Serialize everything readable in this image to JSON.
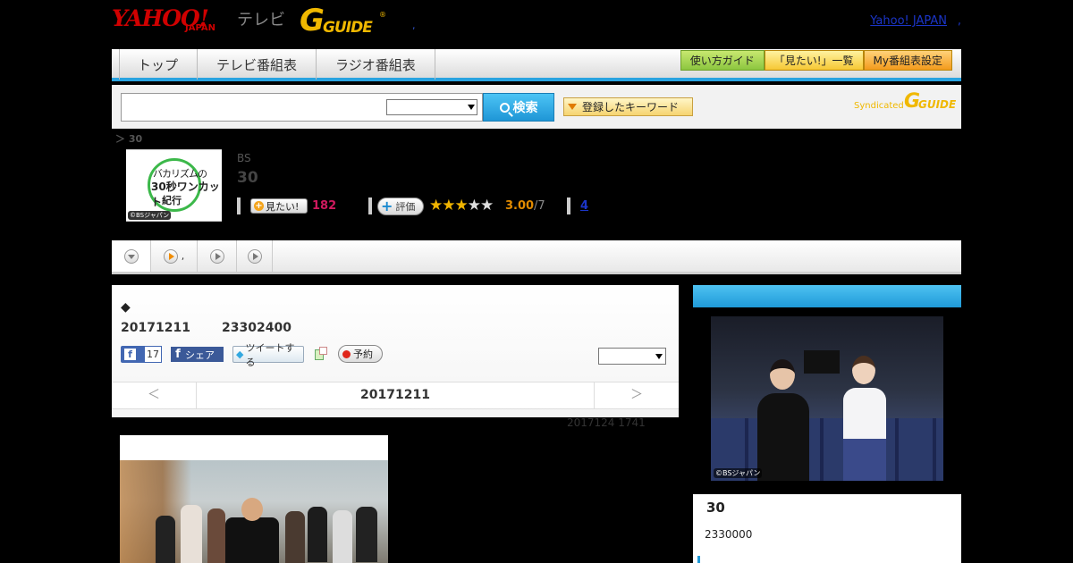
{
  "header": {
    "logo_yahoo": "YAHOO!",
    "logo_japan": "JAPAN",
    "logo_tv": "テレビ",
    "logo_g": "G",
    "logo_guide": "GUIDE",
    "logo_reg": "®",
    "dot": ",",
    "yahoo_japan_link": "Yahoo! JAPAN",
    "yahoo_japan_dot": ","
  },
  "nav": {
    "tabs": [
      {
        "label": "トップ"
      },
      {
        "label": "テレビ番組表"
      },
      {
        "label": "ラジオ番組表"
      }
    ],
    "buttons": [
      {
        "label": "使い方ガイド",
        "color": "#8cc63f"
      },
      {
        "label": "「見たい!」一覧",
        "color": "#f6c834"
      },
      {
        "label": "My番組表設定",
        "color": "#f39a1c"
      }
    ],
    "accent": "#29a3e0"
  },
  "search": {
    "input_value": "",
    "select_value": "",
    "search_button": "検索",
    "keyword_button": "登録したキーワード",
    "syndicated_label": "Syndicated",
    "syndicated_g": "G",
    "syndicated_guide": "GUIDE"
  },
  "breadcrumb": "＞ 30",
  "program": {
    "image_text_1": "バカリズムの",
    "image_text_2": "30秒ワンカット",
    "image_text_3": "紀行",
    "image_copyright": "©BSジャパン",
    "channel": "BS",
    "title": "30",
    "mitai_button": "見たい!",
    "mitai_count": "182",
    "hyoka_button": "評価",
    "rating_stars": 3,
    "rating_max": 5,
    "score": "3.00",
    "score_denominator": "/7",
    "reviews_link": "4"
  },
  "subtabs": {
    "tab2_label": ","
  },
  "main": {
    "diamond": "◆",
    "date": "20171211",
    "time": "23302400",
    "fb_count": "17",
    "fb_share": "シェア",
    "tweet": "ツイートする",
    "yoyaku": "予約",
    "select_value": "",
    "prev": "＜",
    "current_date": "20171211",
    "next": "＞",
    "updated": "2017124  1741"
  },
  "side": {
    "photo_copyright": "©BSジャパン",
    "title": "30",
    "time": "2330000"
  }
}
